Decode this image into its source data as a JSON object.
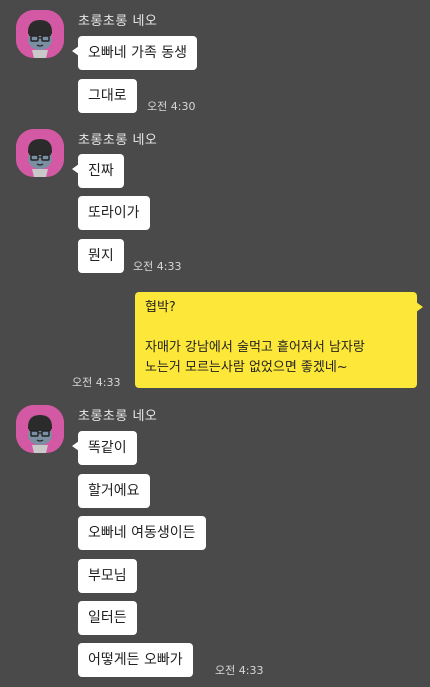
{
  "sender": {
    "name": "초롱초롱 네오"
  },
  "groups": [
    {
      "messages": [
        "오빠네 가족 동생",
        "그대로"
      ],
      "time": "오전 4:30"
    },
    {
      "messages": [
        "진짜",
        "또라이가",
        "뭔지"
      ],
      "time": "오전 4:33"
    },
    {
      "messages": [
        "똑같이",
        "할거에요",
        "오빠네 여동생이든",
        "부모님",
        "일터든",
        "어떻게든 오빠가"
      ],
      "time": "오전 4:33"
    }
  ],
  "my_message": {
    "lines": [
      "협박?",
      "",
      "자매가 강남에서 술먹고 흩어져서 남자랑",
      "노는거 모르는사람 없었으면 좋겠네~"
    ],
    "time": "오전 4:33"
  },
  "colors": {
    "background": "#4a4a4a",
    "my_bubble": "#fde83a",
    "their_bubble": "#ffffff",
    "avatar_bg": "#d459a4"
  },
  "icons": {
    "avatar": "neo-character-avatar-icon"
  }
}
